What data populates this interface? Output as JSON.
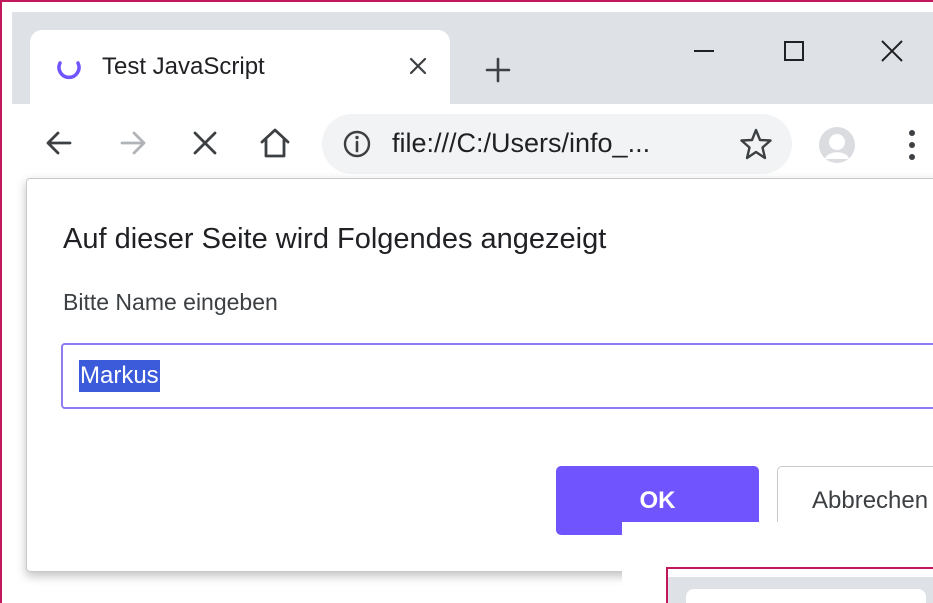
{
  "browser": {
    "tab": {
      "title": "Test JavaScript",
      "favicon": "loading-spinner-icon",
      "close_icon": "close-icon"
    },
    "new_tab_icon": "plus-icon",
    "window_controls": [
      "minimize-icon",
      "maximize-icon",
      "close-icon"
    ],
    "toolbar": {
      "back_icon": "arrow-left-icon",
      "forward_icon": "arrow-right-icon",
      "stop_icon": "close-icon",
      "home_icon": "home-icon",
      "site_info_icon": "info-icon",
      "url": "file:///C:/Users/info_...",
      "bookmark_icon": "star-icon",
      "profile_icon": "profile-icon",
      "menu_icon": "more-vertical-icon"
    }
  },
  "dialog": {
    "title": "Auf dieser Seite wird Folgendes angezeigt",
    "message": "Bitte Name eingeben",
    "input_value": "Markus",
    "ok_label": "OK",
    "cancel_label": "Abbrechen"
  },
  "colors": {
    "accent": "#7055ff",
    "selection": "#3b5bdb",
    "input_focus_border": "#8f7bf2",
    "window_border": "#c2185b",
    "tabstrip": "#dee1e6",
    "omnibox": "#f1f3f4"
  }
}
